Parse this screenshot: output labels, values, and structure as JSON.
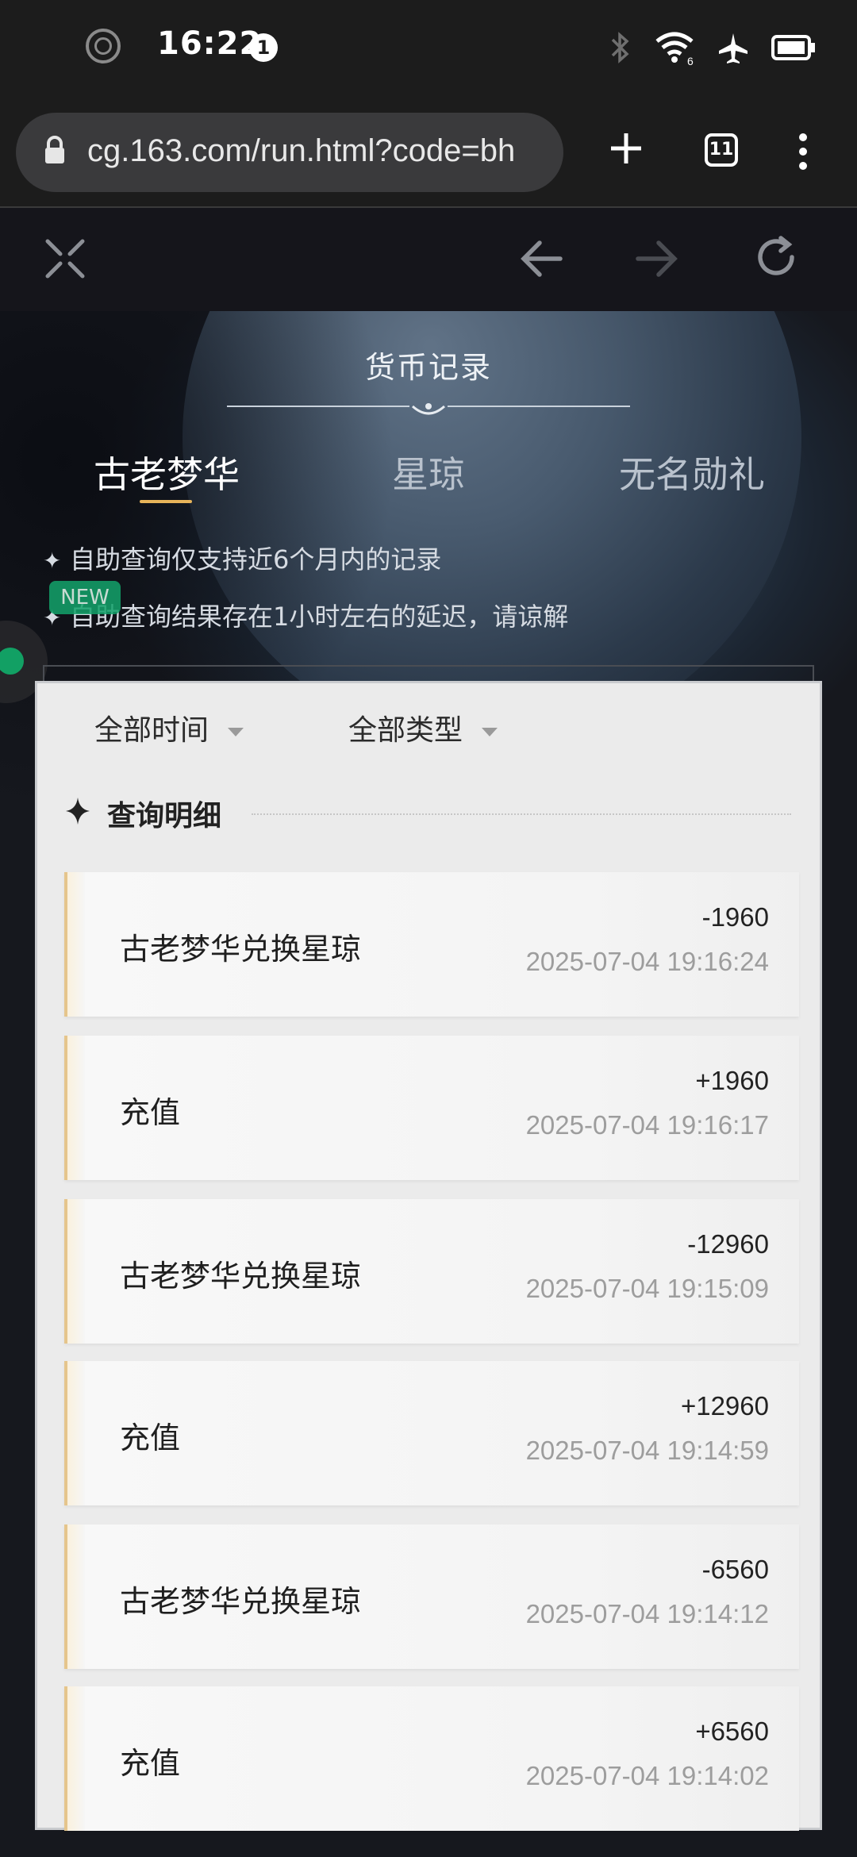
{
  "status_bar": {
    "time": "16:22",
    "notification_count": "1",
    "wifi_label": "6",
    "icons": [
      "record-icon",
      "bluetooth-icon",
      "wifi-icon",
      "airplane-icon",
      "battery-icon"
    ]
  },
  "browser": {
    "url": "cg.163.com/run.html?code=bh",
    "tab_count": "11",
    "icons": [
      "lock-icon",
      "new-tab-plus-icon",
      "tab-switcher-icon",
      "overflow-menu-icon"
    ]
  },
  "app_toolbar": {
    "icons": [
      "close-x-icon",
      "back-arrow-icon",
      "forward-arrow-icon",
      "reload-icon"
    ]
  },
  "page": {
    "title": "货币记录",
    "tabs": [
      {
        "label": "古老梦华",
        "active": true
      },
      {
        "label": "星琼",
        "active": false
      },
      {
        "label": "无名勋礼",
        "active": false
      }
    ],
    "notes": [
      "自助查询仅支持近6个月内的记录",
      "自助查询结果存在1小时左右的延迟，请谅解"
    ],
    "new_badge": "NEW"
  },
  "panel": {
    "filters": {
      "time": "全部时间",
      "type": "全部类型"
    },
    "section_title": "查询明细",
    "records": [
      {
        "title": "古老梦华兑换星琼",
        "amount": "-1960",
        "time": "2025-07-04 19:16:24"
      },
      {
        "title": "充值",
        "amount": "+1960",
        "time": "2025-07-04 19:16:17"
      },
      {
        "title": "古老梦华兑换星琼",
        "amount": "-12960",
        "time": "2025-07-04 19:15:09"
      },
      {
        "title": "充值",
        "amount": "+12960",
        "time": "2025-07-04 19:14:59"
      },
      {
        "title": "古老梦华兑换星琼",
        "amount": "-6560",
        "time": "2025-07-04 19:14:12"
      },
      {
        "title": "充值",
        "amount": "+6560",
        "time": "2025-07-04 19:14:02"
      }
    ]
  },
  "colors": {
    "accent_gold": "#e7b45a",
    "new_badge_green": "#13a36b"
  }
}
